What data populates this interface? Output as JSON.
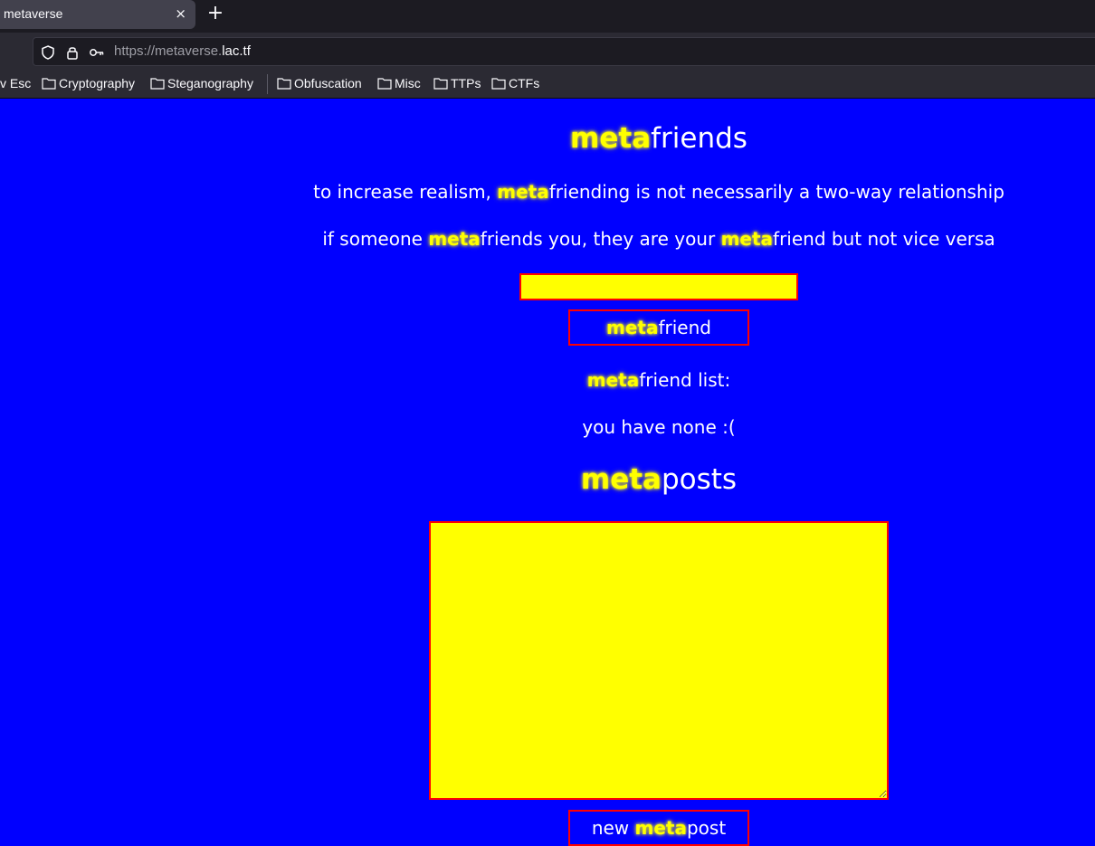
{
  "browser": {
    "tab_title": "metaverse",
    "tab_close": "×",
    "new_tab": "+",
    "url_prefix": "https://metaverse.",
    "url_domain": "lac.tf",
    "bookmarks": [
      "v Esc",
      "Cryptography",
      "Steganography",
      "Obfuscation",
      "Misc",
      "TTPs",
      "CTFs"
    ]
  },
  "page": {
    "meta_word": "meta",
    "friends_heading_rest": "friends",
    "intro_prefix": "to increase realism, ",
    "intro_rest": "friending is not necessarily a two-way relationship",
    "rule_prefix": "if someone ",
    "rule_mid": "friends you, they are your ",
    "rule_rest": "friend but not vice versa",
    "friend_input_value": "",
    "friend_button_rest": "friend",
    "list_label_rest": "friend list:",
    "list_empty": "you have none :(",
    "posts_heading_rest": "posts",
    "post_textarea_value": "",
    "post_button_prefix": "new ",
    "post_button_rest": "post"
  },
  "colors": {
    "background": "#0000ff",
    "meta_accent": "#ffff00",
    "border": "#ff0000",
    "text": "#ffffff"
  }
}
